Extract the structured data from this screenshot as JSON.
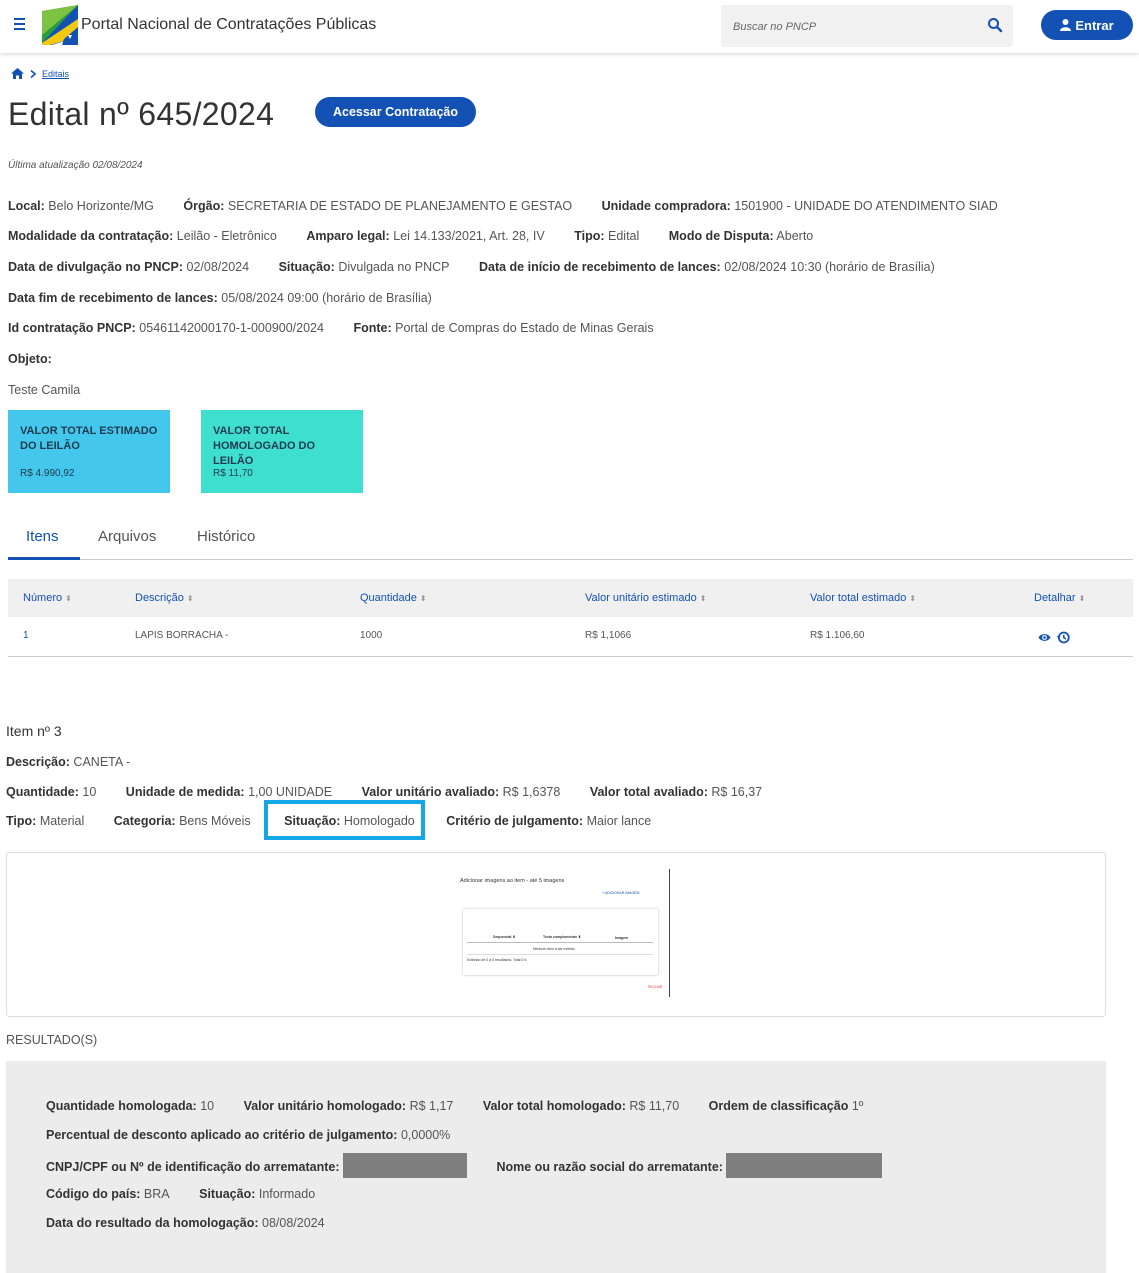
{
  "header": {
    "site_title": "Portal Nacional de Contratações Públicas",
    "search_placeholder": "Buscar no PNCP",
    "login_label": "Entrar"
  },
  "breadcrumb": {
    "link": "Editais"
  },
  "page": {
    "title": "Edital nº 645/2024",
    "access_button": "Acessar Contratação",
    "last_update": "Última atualização 02/08/2024"
  },
  "info": {
    "local_label": "Local:",
    "local_value": "Belo Horizonte/MG",
    "orgao_label": "Órgão:",
    "orgao_value": "SECRETARIA DE ESTADO DE PLANEJAMENTO E GESTAO",
    "unidade_label": "Unidade compradora:",
    "unidade_value": "1501900 - UNIDADE DO ATENDIMENTO SIAD",
    "modalidade_label": "Modalidade da contratação:",
    "modalidade_value": "Leilão - Eletrônico",
    "amparo_label": "Amparo legal:",
    "amparo_value": "Lei 14.133/2021, Art. 28, IV",
    "tipo_label": "Tipo:",
    "tipo_value": "Edital",
    "modo_label": "Modo de Disputa:",
    "modo_value": "Aberto",
    "divulgacao_label": "Data de divulgação no PNCP:",
    "divulgacao_value": "02/08/2024",
    "situacao_label": "Situação:",
    "situacao_value": "Divulgada no PNCP",
    "inicio_label": "Data de início de recebimento de lances:",
    "inicio_value": "02/08/2024 10:30 (horário de Brasília)",
    "fim_label": "Data fim de recebimento de lances:",
    "fim_value": "05/08/2024 09:00 (horário de Brasília)",
    "id_label": "Id contratação PNCP:",
    "id_value": "05461142000170-1-000900/2024",
    "fonte_label": "Fonte:",
    "fonte_value": "Portal de Compras do Estado de Minas Gerais",
    "objeto_label": "Objeto:",
    "objeto_value": "Teste Camila"
  },
  "cards": [
    {
      "title": "VALOR TOTAL ESTIMADO DO LEILÃO",
      "value": "R$ 4.990,92",
      "color": "#44c7ec"
    },
    {
      "title": "VALOR TOTAL HOMOLOGADO DO LEILÃO",
      "value": "R$ 11,70",
      "color": "#3edfcf"
    }
  ],
  "tabs": [
    "Itens",
    "Arquivos",
    "Histórico"
  ],
  "table": {
    "headers": [
      "Número",
      "Descrição",
      "Quantidade",
      "Valor unitário estimado",
      "Valor total estimado",
      "Detalhar"
    ],
    "sort_glyph": "⬍",
    "rows": [
      [
        "1",
        "LAPIS BORRACHA -",
        "1000",
        "R$ 1,1066",
        "R$ 1.106,60"
      ]
    ],
    "detail_icons": [
      "eye-icon",
      "history-icon"
    ]
  },
  "item": {
    "heading": "Item nº 3",
    "descricao_label": "Descrição:",
    "descricao_value": "CANETA -",
    "quantidade_label": "Quantidade:",
    "quantidade_value": "10",
    "unidade_label": "Unidade de medida:",
    "unidade_value": "1,00 UNIDADE",
    "vu_label": "Valor unitário avaliado:",
    "vu_value": "R$ 1,6378",
    "vt_label": "Valor total avaliado:",
    "vt_value": "R$ 16,37",
    "tipo_label": "Tipo:",
    "tipo_value": "Material",
    "categoria_label": "Categoria:",
    "categoria_value": "Bens Móveis",
    "situacao_label": "Situação:",
    "situacao_value": "Homologado",
    "criterio_label": "Critério de julgamento:",
    "criterio_value": "Maior lance",
    "highlight_color": "#14a7e6"
  },
  "preview": {
    "title": "Adicionar imagens ao item - até 5 imagens",
    "add_button": "+ ADICIONAR IMAGEM",
    "col_sequencial": "Sequencial ⬍",
    "col_texto": "Texto complementar ⬍",
    "col_imagem": "Imagem",
    "empty": "Nenhum item a ser exibido",
    "footer": "Exibindo de 0 a 0 resultados. Total 0 it.",
    "cancel": "FECHAR"
  },
  "results": {
    "label": "RESULTADO(S)",
    "qtd_label": "Quantidade homologada:",
    "qtd_value": "10",
    "vu_label": "Valor unitário homologado:",
    "vu_value": "R$ 1,17",
    "vt_label": "Valor total homologado:",
    "vt_value": "R$ 11,70",
    "ordem_label": "Ordem de classificação",
    "ordem_value": "1º",
    "perc_label": "Percentual de desconto aplicado ao critério de julgamento:",
    "perc_value": "0,0000%",
    "cnpj_label": "CNPJ/CPF ou Nº de identificação do arrematante:",
    "nome_label": "Nome ou razão social do arrematante:",
    "pais_label": "Código do país:",
    "pais_value": "BRA",
    "situacao_label": "Situação:",
    "situacao_value": "Informado",
    "data_label": "Data do resultado da homologação:",
    "data_value": "08/08/2024"
  },
  "colors": {
    "primary": "#1351b4",
    "redaction": "#7f7f7f",
    "results_bg": "#ececec"
  }
}
